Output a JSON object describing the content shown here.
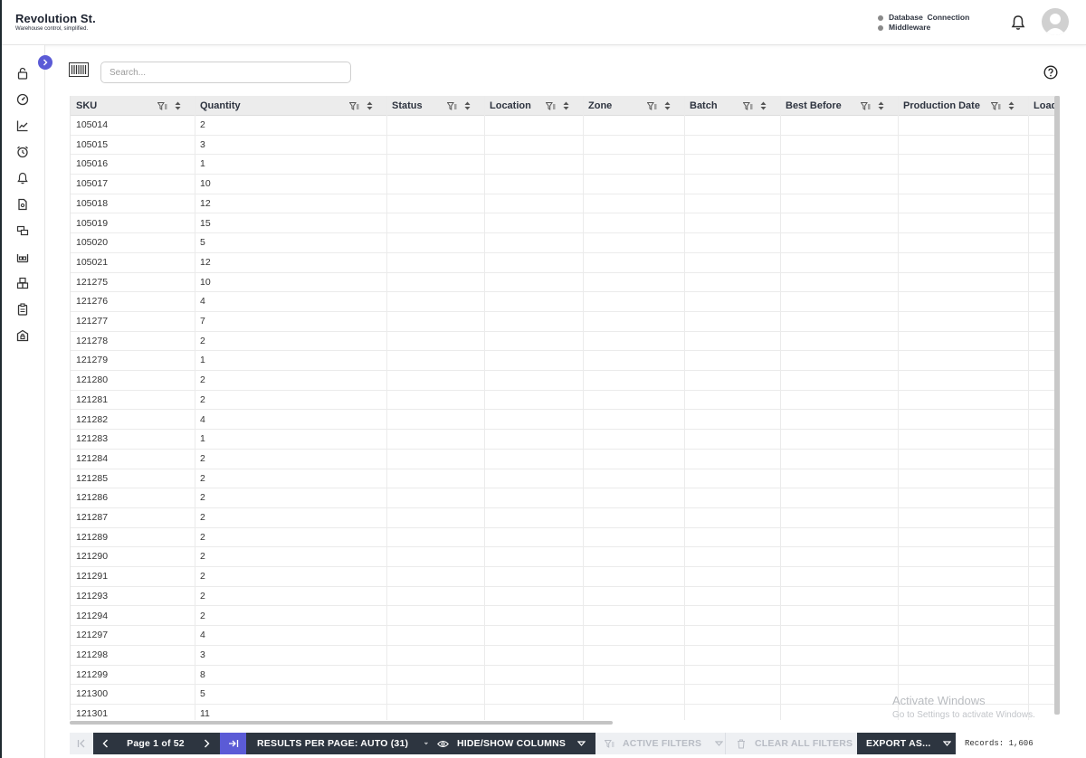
{
  "header": {
    "brand_title": "Revolution St.",
    "brand_subtitle": "Warehouse control, simplified.",
    "status_items": [
      "Database  Connection",
      "Middleware"
    ]
  },
  "sidebar": {
    "items": [
      "lock-icon",
      "dashboard-icon",
      "chart-icon",
      "alarm-icon",
      "bell-icon",
      "document-icon",
      "transfer-icon",
      "warehouse-icon",
      "boxes-icon",
      "clipboard-icon",
      "secure-box-icon"
    ]
  },
  "search": {
    "placeholder": "Search..."
  },
  "grid": {
    "columns": [
      "SKU",
      "Quantity",
      "Status",
      "Location",
      "Zone",
      "Batch",
      "Best Before",
      "Production Date",
      "Load"
    ],
    "rows": [
      [
        "105014",
        "2"
      ],
      [
        "105015",
        "3"
      ],
      [
        "105016",
        "1"
      ],
      [
        "105017",
        "10"
      ],
      [
        "105018",
        "12"
      ],
      [
        "105019",
        "15"
      ],
      [
        "105020",
        "5"
      ],
      [
        "105021",
        "12"
      ],
      [
        "121275",
        "10"
      ],
      [
        "121276",
        "4"
      ],
      [
        "121277",
        "7"
      ],
      [
        "121278",
        "2"
      ],
      [
        "121279",
        "1"
      ],
      [
        "121280",
        "2"
      ],
      [
        "121281",
        "2"
      ],
      [
        "121282",
        "4"
      ],
      [
        "121283",
        "1"
      ],
      [
        "121284",
        "2"
      ],
      [
        "121285",
        "2"
      ],
      [
        "121286",
        "2"
      ],
      [
        "121287",
        "2"
      ],
      [
        "121289",
        "2"
      ],
      [
        "121290",
        "2"
      ],
      [
        "121291",
        "2"
      ],
      [
        "121293",
        "2"
      ],
      [
        "121294",
        "2"
      ],
      [
        "121297",
        "4"
      ],
      [
        "121298",
        "3"
      ],
      [
        "121299",
        "8"
      ],
      [
        "121300",
        "5"
      ],
      [
        "121301",
        "11"
      ]
    ]
  },
  "footer": {
    "page_label": "Page 1 of 52",
    "results_per_page": "RESULTS PER PAGE: AUTO (31)",
    "hide_show": "HIDE/SHOW COLUMNS",
    "active_filters": "ACTIVE FILTERS",
    "clear_filters": "CLEAR ALL FILTERS",
    "export": "EXPORT AS...",
    "records": "Records: 1,606"
  },
  "watermark": {
    "line1": "Activate Windows",
    "line2": "Go to Settings to activate Windows."
  },
  "colors": {
    "accent": "#5b5bd6",
    "footer_dark": "#2d3540",
    "header_bg": "#ececec"
  }
}
